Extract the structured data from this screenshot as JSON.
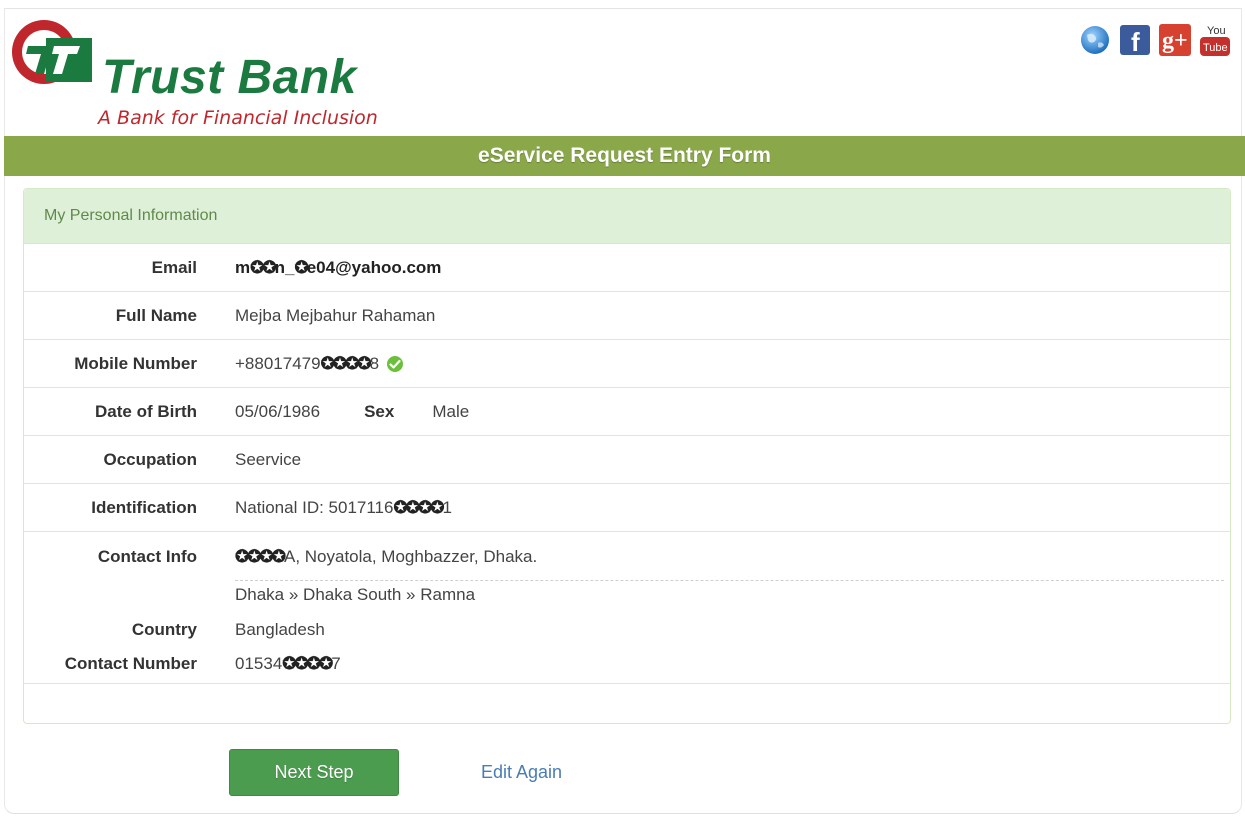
{
  "header": {
    "bank_name": "Trust Bank",
    "tagline": "A Bank for Financial Inclusion",
    "social_icons": [
      "globe-icon",
      "facebook-icon",
      "google-plus-icon",
      "youtube-icon"
    ],
    "google_plus_text": "g+",
    "facebook_text": "f",
    "youtube_top": "You",
    "youtube_bottom": "Tube"
  },
  "title": "eService Request Entry Form",
  "panel": {
    "heading": "My Personal Information"
  },
  "form": {
    "email_label": "Email",
    "email_prefix": "m",
    "email_mask1": "✪✪",
    "email_mid": "n_",
    "email_mask2": "✪",
    "email_suffix": "e04@yahoo.com",
    "full_name_label": "Full Name",
    "full_name": "Mejba Mejbahur Rahaman",
    "mobile_label": "Mobile Number",
    "mobile_prefix": "+88017479",
    "mobile_mask": "✪✪✪✪",
    "mobile_suffix": "8",
    "dob_label": "Date of Birth",
    "dob": "05/06/1986",
    "sex_label": "Sex",
    "sex": "Male",
    "occupation_label": "Occupation",
    "occupation": "Seervice",
    "identification_label": "Identification",
    "id_prefix": "National ID: 5017116",
    "id_mask": "✪✪✪✪",
    "id_suffix": "1",
    "contact_info_label": "Contact Info",
    "address_mask": "✪✪✪✪",
    "address_suffix": "A, Noyatola, Moghbazzer, Dhaka.",
    "region": "Dhaka » Dhaka South » Ramna",
    "country_label": "Country",
    "country": "Bangladesh",
    "contact_number_label": "Contact Number",
    "contact_prefix": "01534",
    "contact_mask": "✪✪✪✪",
    "contact_suffix": "7"
  },
  "actions": {
    "next_label": "Next Step",
    "edit_label": "Edit Again"
  },
  "colors": {
    "brand_green": "#1b7a40",
    "brand_red": "#c0272d",
    "title_bar": "#8aa84a",
    "panel_heading_bg": "#dff0d8",
    "button_green": "#4c9c4f",
    "link_blue": "#4a7db3"
  }
}
